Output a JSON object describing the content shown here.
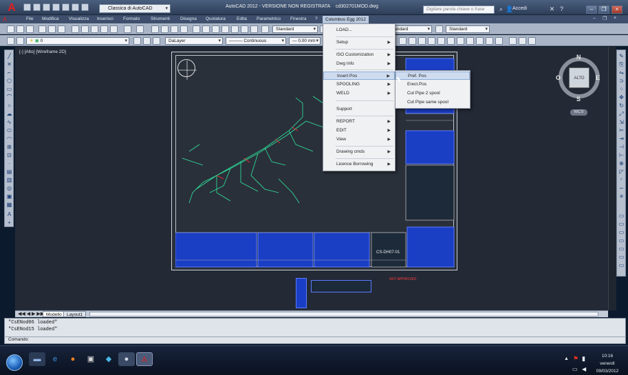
{
  "titlebar": {
    "workspace": "Classica di AutoCAD",
    "title": "AutoCAD 2012 - VERSIONE NON REGISTRATA",
    "filename": "cd302701MOD.dwg",
    "search_placeholder": "Digitare parola chiave o frase",
    "signin": "Accedi"
  },
  "menubar": {
    "items": [
      "File",
      "Modifica",
      "Visualizza",
      "Inserisci",
      "Formato",
      "Strumenti",
      "Disegna",
      "Quotatura",
      "Edita",
      "Parametrico",
      "Finestra",
      "?",
      "Columbus Egg 2012"
    ]
  },
  "toolbar1": {
    "text_style": "Standard",
    "dim_style": "Standard",
    "table_style": "Standard",
    "multileader_style": "Standard"
  },
  "toolbar2": {
    "layer": "0",
    "color": "DaLayer",
    "linetype": "Continuous",
    "lineweight": "0.00 mm"
  },
  "viewport": {
    "label": "[-] [Alto] [Wireframe 2D]"
  },
  "viewcube": {
    "n": "N",
    "s": "S",
    "e": "E",
    "o": "O",
    "face": "ALTO",
    "wcs": "WCS"
  },
  "tabs": [
    "Modello",
    "Layout1"
  ],
  "command": {
    "lines": [
      "\"CsENod06 loaded\"",
      "\"CsENod15 loaded\""
    ],
    "prompt": "Comando:"
  },
  "dropdown": {
    "items": [
      {
        "label": "LOAD...",
        "arrow": false
      },
      {
        "label": "Setup",
        "arrow": true
      },
      {
        "label": "ISO Customization",
        "arrow": true
      },
      {
        "label": "Dwg Info",
        "arrow": true
      },
      {
        "label": "Insert Pos",
        "arrow": true,
        "highlight": true
      },
      {
        "label": "SPOOLING",
        "arrow": true
      },
      {
        "label": "WELD",
        "arrow": true
      },
      {
        "label": "Support",
        "arrow": false
      },
      {
        "label": "REPORT",
        "arrow": true
      },
      {
        "label": "EDIT",
        "arrow": true
      },
      {
        "label": "View",
        "arrow": true
      },
      {
        "label": "Drawing cmds",
        "arrow": true
      },
      {
        "label": "Licence Borrowing",
        "arrow": true
      }
    ]
  },
  "submenu": {
    "items": [
      "Pref. Pos",
      "Erect.Pos",
      "Cut Pipe 2 spool",
      "Cut Pipe same spool"
    ]
  },
  "drawing": {
    "code": "CS-DH07-01",
    "status": "NOT APPROVED"
  },
  "taskbar": {
    "time": "10:16",
    "day": "venerdì",
    "date": "09/03/2012"
  }
}
